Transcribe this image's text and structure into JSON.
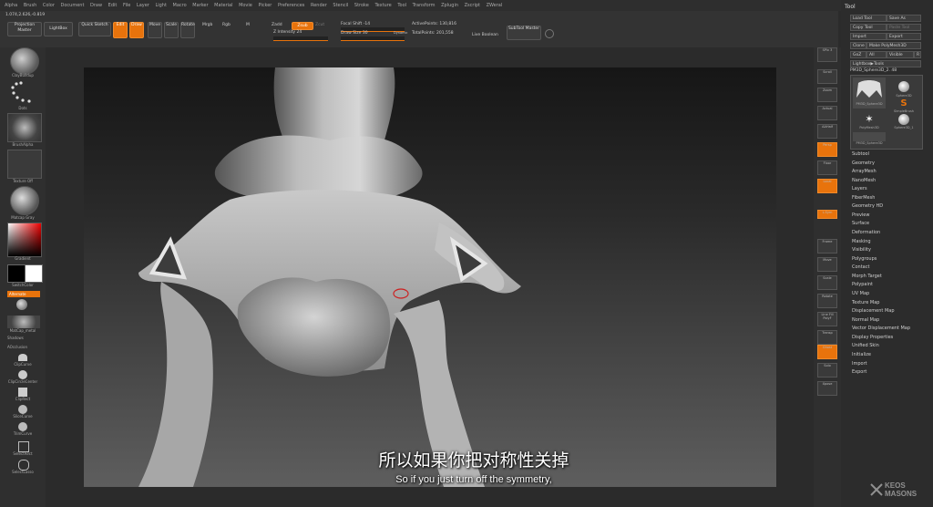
{
  "menubar": [
    "Alpha",
    "Brush",
    "Color",
    "Document",
    "Draw",
    "Edit",
    "File",
    "Layer",
    "Light",
    "Macro",
    "Marker",
    "Material",
    "Movie",
    "Picker",
    "Preferences",
    "Render",
    "Stencil",
    "Stroke",
    "Texture",
    "Tool",
    "Transform",
    "Zplugin",
    "Zscript",
    "ZWeral"
  ],
  "coords": "1.074,2.626,-0.819",
  "topbar": {
    "projection_master": "Projection Master",
    "lightbox": "LightBox",
    "quick_sketch": "Quick Sketch",
    "edit": "Edit",
    "draw": "Draw",
    "move": "Move",
    "scale": "Scale",
    "rotate": "Rotate",
    "mrgb": "Mrgb",
    "rgb": "Rgb",
    "m": "M",
    "zadd": "Zadd",
    "zsub": "Zsub",
    "zcut": "Zcut",
    "z_intensity": "Z Intensity 24",
    "focal_shift": "Focal Shift -14",
    "draw_size": "Draw Size 30",
    "dynamic": "Dynamic",
    "active_points": "ActivePoints: 130,816",
    "total_points": "TotalPoints: 201,558",
    "live_boolean": "Live Boolean",
    "subtool_master": "SubTool Master"
  },
  "leftshelf": {
    "brush": "ClayBuildup",
    "stroke": "Dots",
    "alpha": "BrushAlpha",
    "texture": "Texture Off",
    "material": "Matcap Gray",
    "gradient": "Gradient",
    "switchcolor": "SwitchColor",
    "alternate": "Alternate",
    "material2": "MatCap_metal",
    "shadows": "Shadows",
    "ao": "AOcclusion",
    "clipcurve": "ClipCurve",
    "clipcircle": "ClipCircleCenter",
    "cliprect": "ClipRect",
    "slicecurve": "SliceCurve",
    "trimcurve": "TrimCurve",
    "selectrect": "SelectRect",
    "selectlasso": "SelectLasso"
  },
  "rightshelf": [
    "SPix 3",
    "Scroll",
    "Zoom",
    "Actual",
    "AAHalf",
    "Persp",
    "Floor",
    "Local",
    "L.Sym",
    "Frame",
    "Move",
    "Scale",
    "Rotate",
    "Line Fill PolyF",
    "Transp",
    "Ghost",
    "Solo",
    "Xpose"
  ],
  "toolpanel": {
    "title": "Tool",
    "load_tool": "Load Tool",
    "save_as": "Save As",
    "copy_tool": "Copy Tool",
    "paste_tool": "Paste Tool",
    "import": "Import",
    "export": "Export",
    "clone": "Clone",
    "make_polymesh": "Make PolyMesh3D",
    "goz": "GoZ",
    "all": "All",
    "visible": "Visible",
    "r": "R",
    "lightbox_tools": "Lightbox▶Tools",
    "current_tool": "PM3D_Sphere3D_2. 48",
    "tools": [
      "PM3D_Sphere3D",
      "Sphere3D",
      "SimpleBrush",
      "PolyMesh3D",
      "Sphere3D_1",
      "PM3D_Sphere3D"
    ],
    "items": [
      "Subtool",
      "Geometry",
      "ArrayMesh",
      "NanoMesh",
      "Layers",
      "FiberMesh",
      "Geometry HD",
      "Preview",
      "Surface",
      "Deformation",
      "Masking",
      "Visibility",
      "Polygroups",
      "Contact",
      "Morph Target",
      "Polypaint",
      "UV Map",
      "Texture Map",
      "Displacement Map",
      "Normal Map",
      "Vector Displacement Map",
      "Display Properties",
      "Unified Skin",
      "Initialize",
      "Import",
      "Export"
    ]
  },
  "subtitles": {
    "zh": "所以如果你把对称性关掉",
    "en": "So if you just turn off the symmetry,"
  },
  "watermark": "KEOS MASONS"
}
